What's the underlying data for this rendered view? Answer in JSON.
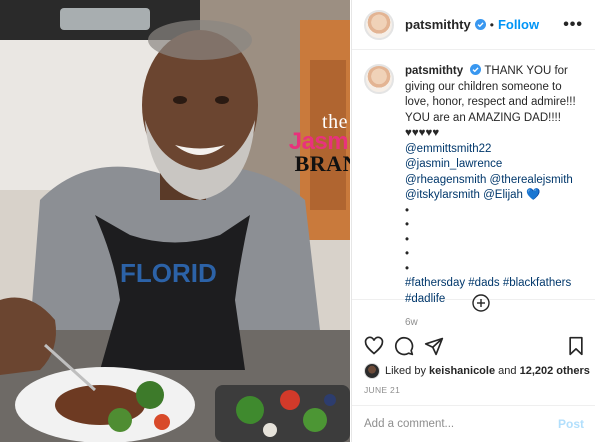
{
  "header": {
    "username": "patsmithty",
    "separator": "•",
    "follow_label": "Follow",
    "more_label": "•••"
  },
  "watermark": {
    "line1": "the",
    "line2": "Jasmine",
    "line3": "BRAND"
  },
  "caption": {
    "username": "patsmithty",
    "text": "THANK YOU for giving our children someone to love, honor, respect and admire!!! YOU are an AMAZING DAD!!!!♥♥♥♥♥",
    "mentions_line1": "@emmittsmith22 @jasmin_lawrence",
    "mentions_line2": "@rheagensmith @therealejsmith",
    "mentions_line3": "@itskylarsmith @Elijah 💙",
    "dots": [
      "•",
      "•",
      "•",
      "•",
      "•"
    ],
    "hashtags": "#fathersday #dads #blackfathers #dadlife",
    "age": "6w"
  },
  "likes": {
    "prefix": "Liked by",
    "first_user": "keishanicole",
    "middle": "and",
    "count": "12,202 others"
  },
  "date": "JUNE 21",
  "comment": {
    "placeholder": "Add a comment...",
    "post_label": "Post"
  },
  "colors": {
    "link": "#00376b",
    "follow": "#0095f6",
    "verified": "#3897f0",
    "post_disabled": "#b2dffc",
    "watermark_pink": "#e8327c"
  },
  "icons": {
    "verified": "verified-badge-icon",
    "more": "more-options-icon",
    "load_more": "plus-circle-icon",
    "like": "heart-icon",
    "comment": "comment-icon",
    "share": "send-icon",
    "save": "bookmark-icon"
  }
}
